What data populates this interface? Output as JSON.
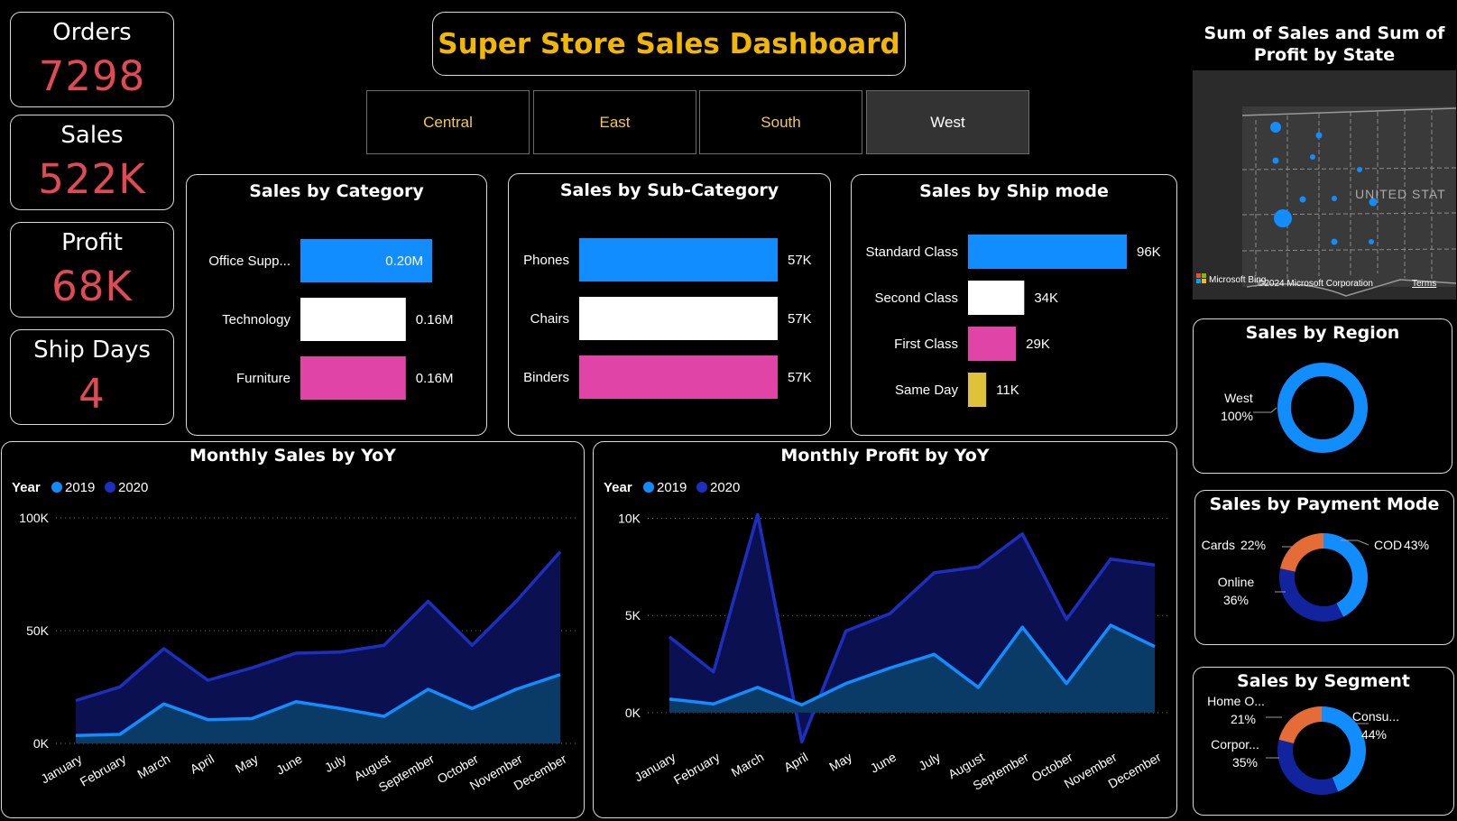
{
  "kpis": [
    {
      "label": "Orders",
      "value": "7298"
    },
    {
      "label": "Sales",
      "value": "522K"
    },
    {
      "label": "Profit",
      "value": "68K"
    },
    {
      "label": "Ship Days",
      "value": "4"
    }
  ],
  "title": "Super Store Sales Dashboard",
  "slicers": [
    {
      "label": "Central",
      "selected": false
    },
    {
      "label": "East",
      "selected": false
    },
    {
      "label": "South",
      "selected": false
    },
    {
      "label": "West",
      "selected": true
    }
  ],
  "map": {
    "title": "Sum of Sales and Sum of Profit by State",
    "country_label": "UNITED STAT",
    "attribution": "Microsoft Bing",
    "copyright": "©2024 Microsoft Corporation",
    "terms": "Terms"
  },
  "colors": {
    "blue": "#118dff",
    "white": "#ffffff",
    "pink": "#e044a7",
    "yellow": "#e0c23a",
    "navy": "#12239e",
    "orange": "#e66c37",
    "red_kpi": "#e04a55",
    "title_gold": "#f2b705"
  },
  "chart_data": [
    {
      "id": "category",
      "type": "bar",
      "orientation": "horizontal",
      "title": "Sales by Category",
      "categories": [
        "Office Supp...",
        "Technology",
        "Furniture"
      ],
      "values": [
        0.2,
        0.16,
        0.16
      ],
      "labels": [
        "0.20M",
        "0.16M",
        "0.16M"
      ],
      "unit": "M",
      "colors": [
        "#118dff",
        "#ffffff",
        "#e044a7"
      ]
    },
    {
      "id": "subcategory",
      "type": "bar",
      "orientation": "horizontal",
      "title": "Sales by Sub-Category",
      "categories": [
        "Phones",
        "Chairs",
        "Binders"
      ],
      "values": [
        57,
        57,
        57
      ],
      "labels": [
        "57K",
        "57K",
        "57K"
      ],
      "unit": "K",
      "colors": [
        "#118dff",
        "#ffffff",
        "#e044a7"
      ]
    },
    {
      "id": "shipmode",
      "type": "bar",
      "orientation": "horizontal",
      "title": "Sales by Ship mode",
      "categories": [
        "Standard Class",
        "Second Class",
        "First Class",
        "Same Day"
      ],
      "values": [
        96,
        34,
        29,
        11
      ],
      "labels": [
        "96K",
        "34K",
        "29K",
        "11K"
      ],
      "unit": "K",
      "colors": [
        "#118dff",
        "#ffffff",
        "#e044a7",
        "#e0c23a"
      ]
    },
    {
      "id": "region",
      "type": "pie",
      "donut": true,
      "title": "Sales by Region",
      "slices": [
        {
          "name": "West",
          "value": 100,
          "label": "100%",
          "color": "#118dff"
        }
      ]
    },
    {
      "id": "payment",
      "type": "pie",
      "donut": true,
      "title": "Sales by Payment Mode",
      "slices": [
        {
          "name": "COD",
          "value": 43,
          "label": "43%",
          "color": "#118dff"
        },
        {
          "name": "Online",
          "value": 36,
          "label": "36%",
          "color": "#12239e"
        },
        {
          "name": "Cards",
          "value": 22,
          "label": "22%",
          "color": "#e66c37"
        }
      ]
    },
    {
      "id": "segment",
      "type": "pie",
      "donut": true,
      "title": "Sales by Segment",
      "slices": [
        {
          "name": "Consu...",
          "value": 44,
          "label": "44%",
          "color": "#118dff"
        },
        {
          "name": "Corpor...",
          "value": 35,
          "label": "35%",
          "color": "#12239e"
        },
        {
          "name": "Home O...",
          "value": 21,
          "label": "21%",
          "color": "#e66c37"
        }
      ]
    },
    {
      "id": "monthly_sales",
      "type": "area",
      "title": "Monthly Sales by YoY",
      "legend_title": "Year",
      "legend_position": "top-left",
      "categories": [
        "January",
        "February",
        "March",
        "April",
        "May",
        "June",
        "July",
        "August",
        "September",
        "October",
        "November",
        "December"
      ],
      "series": [
        {
          "name": "2019",
          "color": "#118dff",
          "values": [
            3500,
            4000,
            17500,
            10500,
            11000,
            18500,
            15500,
            12000,
            24000,
            15500,
            24000,
            30500
          ]
        },
        {
          "name": "2020",
          "color": "#12239e",
          "values": [
            19000,
            25000,
            42000,
            28000,
            33500,
            40000,
            40500,
            43500,
            63000,
            43500,
            63000,
            85000
          ]
        }
      ],
      "yticks": [
        0,
        50000,
        100000
      ],
      "ytick_labels": [
        "0K",
        "50K",
        "100K"
      ],
      "ylim": [
        0,
        100000
      ],
      "grid": true
    },
    {
      "id": "monthly_profit",
      "type": "area",
      "title": "Monthly Profit by YoY",
      "legend_title": "Year",
      "legend_position": "top-left",
      "categories": [
        "January",
        "February",
        "March",
        "April",
        "May",
        "June",
        "July",
        "August",
        "September",
        "October",
        "November",
        "December"
      ],
      "series": [
        {
          "name": "2019",
          "color": "#118dff",
          "values": [
            700,
            450,
            1300,
            400,
            1500,
            2300,
            3000,
            1300,
            4400,
            1500,
            4500,
            3400
          ]
        },
        {
          "name": "2020",
          "color": "#12239e",
          "values": [
            3900,
            2100,
            10200,
            -1500,
            4200,
            5100,
            7200,
            7500,
            9200,
            4800,
            7900,
            7600
          ]
        }
      ],
      "yticks": [
        0,
        5000,
        10000
      ],
      "ytick_labels": [
        "0K",
        "5K",
        "10K"
      ],
      "ylim": [
        -2000,
        11000
      ],
      "grid": true
    }
  ]
}
